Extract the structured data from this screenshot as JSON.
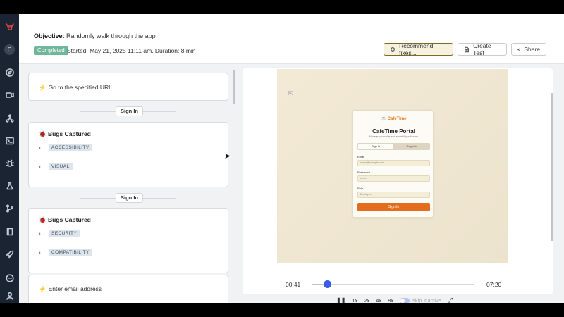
{
  "header": {
    "objective_label": "Objective:",
    "objective_text": "Randomly walk through the app",
    "status": "Completed",
    "started": "Started: May 21, 2025 11:11 am. Duration: 8 min",
    "recommend_label": "Recommend fixes...",
    "create_label": "Create Test",
    "share_label": "Share"
  },
  "rail": {
    "avatar_letter": "C"
  },
  "steps": {
    "goto_url": "Go to the specified URL.",
    "divider1": "Sign In",
    "bugs1_title": "Bugs Captured",
    "bugs1_tags": [
      "ACCESSIBILITY",
      "VISUAL"
    ],
    "divider2": "Sign In",
    "bugs2_title": "Bugs Captured",
    "bugs2_tags": [
      "SECURITY",
      "COMPATIBILITY"
    ],
    "enter_email": "Enter email address"
  },
  "video": {
    "brand": "CafeTime",
    "portal_title": "CafeTime Portal",
    "portal_subtitle": "Manage your shifts and availability with ease",
    "tab_signin": "Sign In",
    "tab_register": "Register",
    "email_label": "Email",
    "email_placeholder": "name@example.com",
    "password_label": "Password",
    "password_placeholder": "••••••••",
    "role_label": "Role",
    "role_value": "Employee",
    "submit_label": "Sign In"
  },
  "player": {
    "current_time": "00:41",
    "total_time": "07:20",
    "progress": 0.09,
    "speeds": [
      "1x",
      "2x",
      "4x",
      "8x"
    ],
    "skip_inactive_label": "skip inactive"
  },
  "colors": {
    "accent": "#3c5ce8",
    "completed_badge": "#6fb79a",
    "rail_bg": "#1a2433"
  }
}
